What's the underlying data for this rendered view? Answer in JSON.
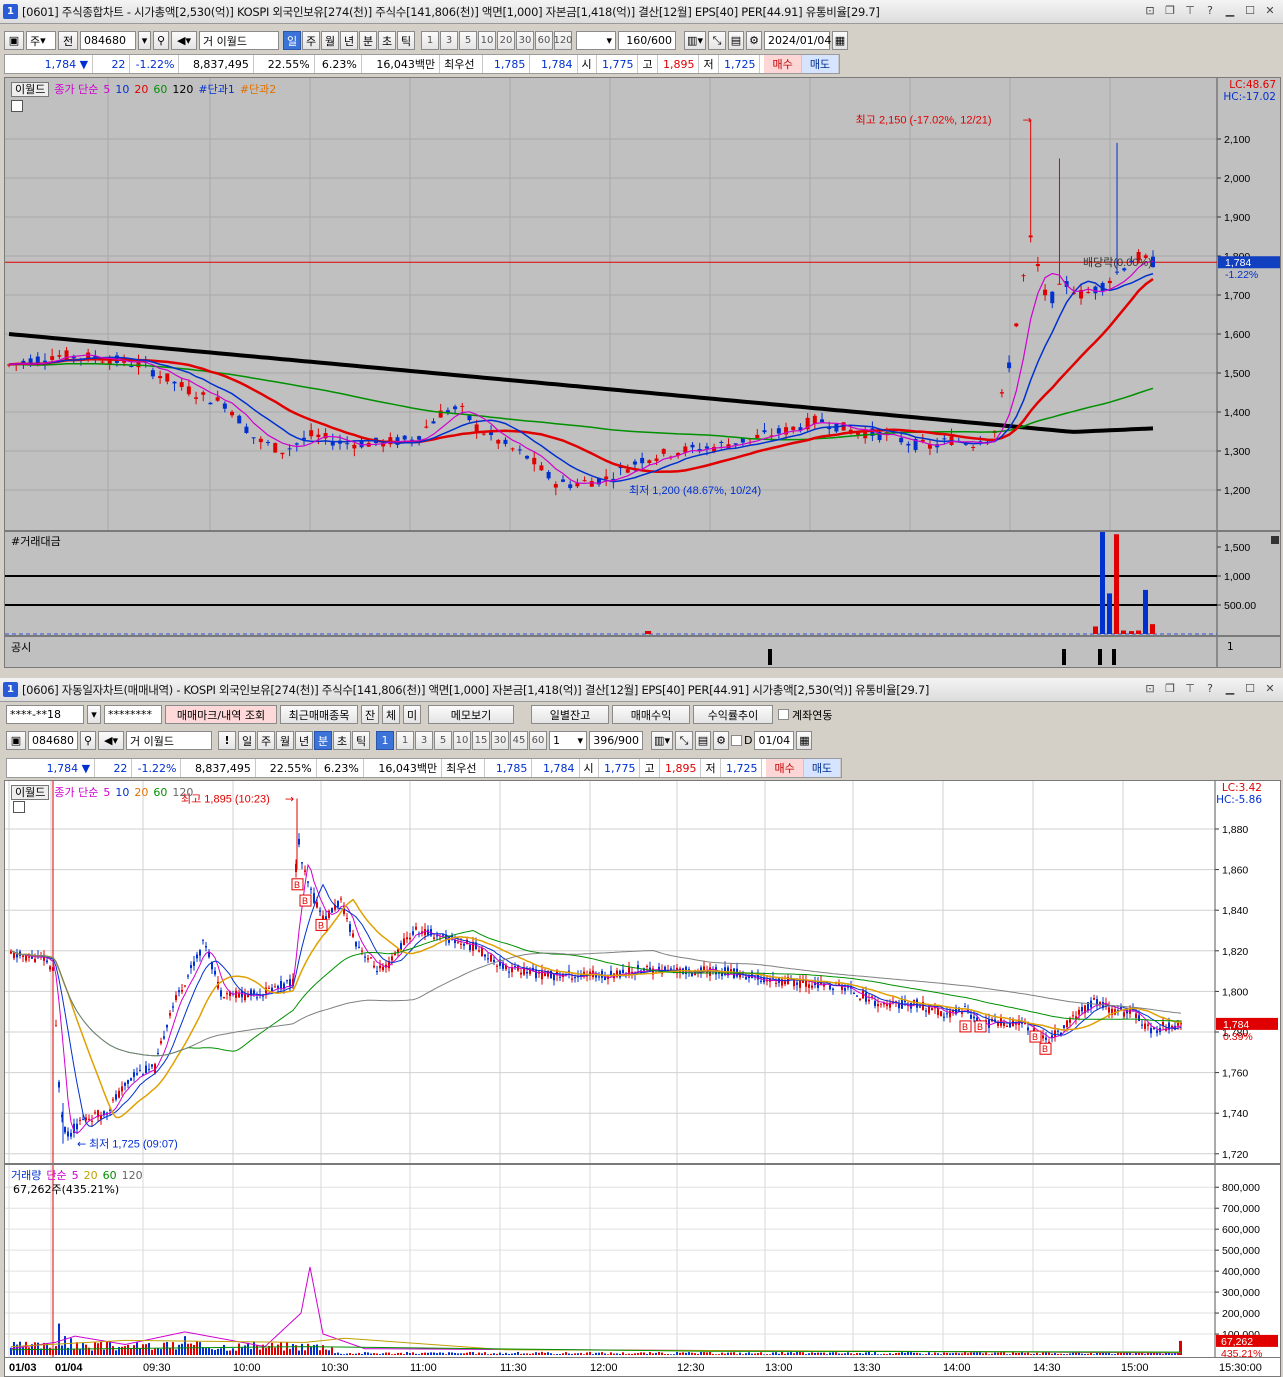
{
  "win1": {
    "num": "1",
    "title": "[0601] 주식종합차트 - 시가총액[2,530(억)] KOSPI 외국인보유[274(천)] 주식수[141,806(천)] 액면[1,000] 자본금[1,418(억)] 결산[12월] EPS[40] PER[44.91] 유통비율[29.7]",
    "toolbar": {
      "market": "주",
      "prev": "전",
      "code": "084680",
      "name_prefix": "거",
      "name": "이월드",
      "periods": [
        "일",
        "주",
        "월",
        "년",
        "분",
        "초",
        "틱"
      ],
      "selected_period": "일",
      "minutes": [
        "1",
        "3",
        "5",
        "10",
        "20",
        "30",
        "60",
        "120"
      ],
      "count": "160",
      "count_max": "/600",
      "date": "2024/01/04"
    },
    "info": {
      "price": "1,784",
      "arrow": "▼",
      "change": "22",
      "rate": "-1.22%",
      "volume": "8,837,495",
      "v1": "22.55%",
      "v2": "6.23%",
      "amount": "16,043백만",
      "best_label": "최우선",
      "ask": "1,785",
      "bid": "1,784",
      "open_label": "시",
      "open": "1,775",
      "high_label": "고",
      "high": "1,895",
      "low_label": "저",
      "low": "1,725",
      "buy": "매수",
      "sell": "매도"
    },
    "legend": {
      "name": "이월드",
      "ma_label": "종가 단순",
      "ma": [
        "5",
        "10",
        "20",
        "60",
        "120"
      ],
      "ind1": "#단과1",
      "ind2": "#단과2"
    },
    "lc": "LC:48.67",
    "hc": "HC:-17.02",
    "price_axis": [
      "2,100",
      "2,000",
      "1,900",
      "1,800",
      "1,700",
      "1,600",
      "1,500",
      "1,400",
      "1,300",
      "1,200"
    ],
    "current_price": "1,784",
    "current_rate": "-1.22%",
    "high_note": "최고 2,150 (-17.02%, 12/21)",
    "low_note": "최저 1,200 (48.67%, 10/24)",
    "base_note": "배당락(0.00%)",
    "vol_title": "#거래대금",
    "vol_axis": [
      "1,500",
      "1,000",
      "500.00"
    ],
    "notice_title": "공시",
    "notice_axis": "1"
  },
  "win2": {
    "num": "1",
    "title": "[0606] 자동일자차트(매매내역) - KOSPI 외국인보유[274(천)] 주식수[141,806(천)] 액면[1,000] 자본금[1,418(억)] 결산[12월] EPS[40] PER[44.91] 시가총액[2,530(억)] 유통비율[29.7]",
    "toolbar1": {
      "account": "****-**18",
      "password": "********",
      "mark_btn": "매매마크/내역 조회",
      "recent_btn": "최근매매종목",
      "b1": "잔",
      "b2": "체",
      "b3": "미",
      "memo": "메모보기",
      "daily": "일별잔고",
      "profit": "매매수익",
      "trend": "수익률추이",
      "link": "계좌연동"
    },
    "toolbar2": {
      "code": "084680",
      "name_prefix": "거",
      "name": "이월드",
      "periods": [
        "일",
        "주",
        "월",
        "년",
        "분",
        "초",
        "틱"
      ],
      "selected_period": "분",
      "sel_num": "1",
      "minutes": [
        "1",
        "3",
        "5",
        "10",
        "15",
        "30",
        "45",
        "60"
      ],
      "unit": "1",
      "count": "396",
      "count_max": "/900",
      "d_label": "D",
      "date": "01/04"
    },
    "legend": {
      "name": "이월드",
      "ma_label": "종가 단순",
      "ma": [
        "5",
        "10",
        "20",
        "60",
        "120"
      ]
    },
    "lc": "LC:3.42",
    "hc": "HC:-5.86",
    "price_axis": [
      "1,880",
      "1,860",
      "1,840",
      "1,820",
      "1,800",
      "1,780",
      "1,760",
      "1,740",
      "1,720"
    ],
    "current_price": "1,784",
    "current_rate": "0.39%",
    "high_note": "최고 1,895 (10:23)",
    "low_note": "최저 1,725 (09:07)",
    "vol_legend": {
      "name": "거래량",
      "ma_label": "단순",
      "ma": [
        "5",
        "20",
        "60",
        "120"
      ],
      "value": "67,262주(435.21%)"
    },
    "vol_axis": [
      "800,000",
      "700,000",
      "600,000",
      "500,000",
      "400,000",
      "300,000",
      "200,000",
      "100,000"
    ],
    "vol_current": "67,262",
    "vol_rate": "435.21%",
    "time_axis": [
      "01/03",
      "01/04",
      "09:30",
      "10:00",
      "10:30",
      "11:00",
      "11:30",
      "12:00",
      "12:30",
      "13:00",
      "13:30",
      "14:00",
      "14:30",
      "15:00",
      "15:30:00"
    ]
  },
  "colors": {
    "up": "#e00000",
    "down": "#0030d0",
    "ma5": "#d000d0",
    "ma10": "#0030d0",
    "ma20": "#e00000",
    "ma60": "#009000",
    "ma120": "#000000"
  }
}
